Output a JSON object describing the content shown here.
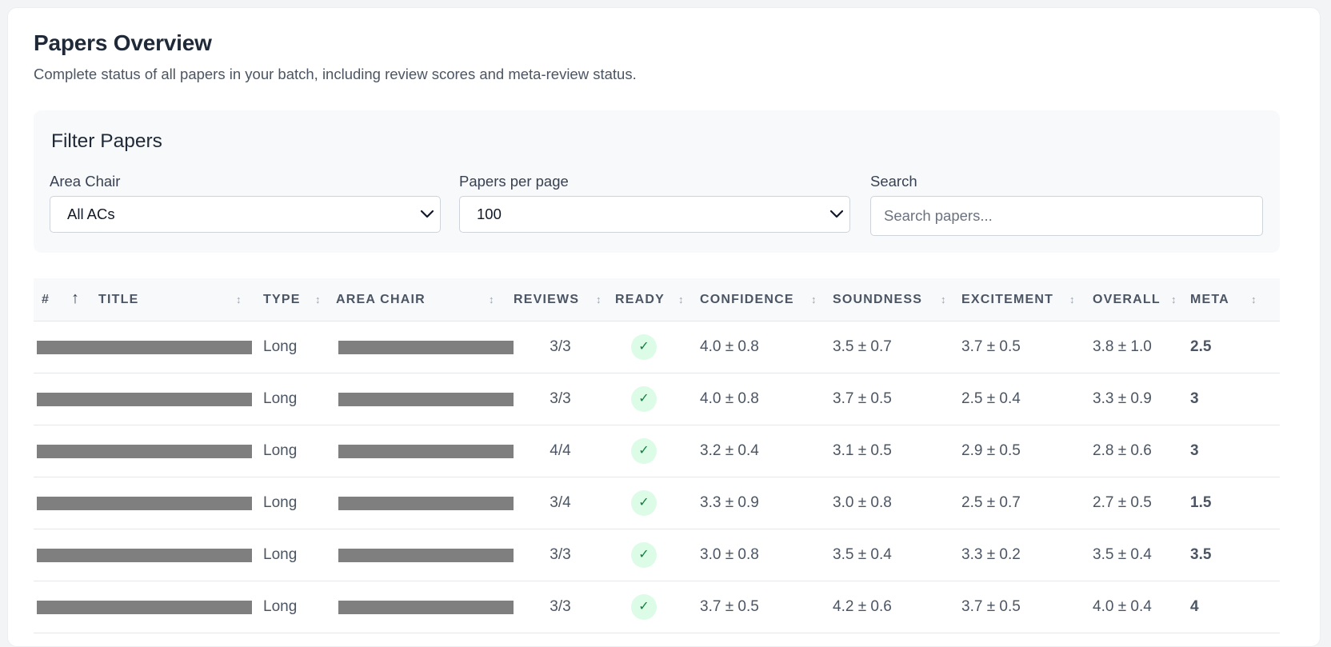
{
  "header": {
    "title": "Papers Overview",
    "subtitle": "Complete status of all papers in your batch, including review scores and meta-review status."
  },
  "filters": {
    "title": "Filter Papers",
    "area_chair_label": "Area Chair",
    "area_chair_value": "All ACs",
    "per_page_label": "Papers per page",
    "per_page_value": "100",
    "search_label": "Search",
    "search_placeholder": "Search papers...",
    "search_value": ""
  },
  "table": {
    "columns": [
      {
        "key": "num",
        "label": "#",
        "sortable": false
      },
      {
        "key": "sort_up",
        "label": "↑",
        "sortable": true
      },
      {
        "key": "title",
        "label": "TITLE",
        "sortable": true
      },
      {
        "key": "type",
        "label": "TYPE",
        "sortable": true
      },
      {
        "key": "area_chair",
        "label": "AREA CHAIR",
        "sortable": true
      },
      {
        "key": "reviews",
        "label": "REVIEWS",
        "sortable": true
      },
      {
        "key": "ready",
        "label": "READY",
        "sortable": true
      },
      {
        "key": "confidence",
        "label": "CONFIDENCE",
        "sortable": true
      },
      {
        "key": "soundness",
        "label": "SOUNDNESS",
        "sortable": true
      },
      {
        "key": "excitement",
        "label": "EXCITEMENT",
        "sortable": true
      },
      {
        "key": "overall",
        "label": "OVERALL",
        "sortable": true
      },
      {
        "key": "meta",
        "label": "META",
        "sortable": true
      }
    ],
    "sort_indicator": "↕",
    "rows": [
      {
        "type": "Long",
        "reviews": "3/3",
        "ready": "✓",
        "confidence": "4.0 ± 0.8",
        "soundness": "3.5 ± 0.7",
        "excitement": "3.7 ± 0.5",
        "overall": "3.8 ± 1.0",
        "meta": "2.5"
      },
      {
        "type": "Long",
        "reviews": "3/3",
        "ready": "✓",
        "confidence": "4.0 ± 0.8",
        "soundness": "3.7 ± 0.5",
        "excitement": "2.5 ± 0.4",
        "overall": "3.3 ± 0.9",
        "meta": "3"
      },
      {
        "type": "Long",
        "reviews": "4/4",
        "ready": "✓",
        "confidence": "3.2 ± 0.4",
        "soundness": "3.1 ± 0.5",
        "excitement": "2.9 ± 0.5",
        "overall": "2.8 ± 0.6",
        "meta": "3"
      },
      {
        "type": "Long",
        "reviews": "3/4",
        "ready": "✓",
        "confidence": "3.3 ± 0.9",
        "soundness": "3.0 ± 0.8",
        "excitement": "2.5 ± 0.7",
        "overall": "2.7 ± 0.5",
        "meta": "1.5"
      },
      {
        "type": "Long",
        "reviews": "3/3",
        "ready": "✓",
        "confidence": "3.0 ± 0.8",
        "soundness": "3.5 ± 0.4",
        "excitement": "3.3 ± 0.2",
        "overall": "3.5 ± 0.4",
        "meta": "3.5"
      },
      {
        "type": "Long",
        "reviews": "3/3",
        "ready": "✓",
        "confidence": "3.7 ± 0.5",
        "soundness": "4.2 ± 0.6",
        "excitement": "3.7 ± 0.5",
        "overall": "4.0 ± 0.4",
        "meta": "4"
      }
    ]
  },
  "colors": {
    "ready_badge_bg": "#dcfce7",
    "ready_badge_fg": "#15803d",
    "redaction": "#7f7f7f"
  },
  "icons": {
    "select_chevron": "chevron-down-icon",
    "ready": "checkmark-icon",
    "sort": "sort-arrows-icon"
  }
}
